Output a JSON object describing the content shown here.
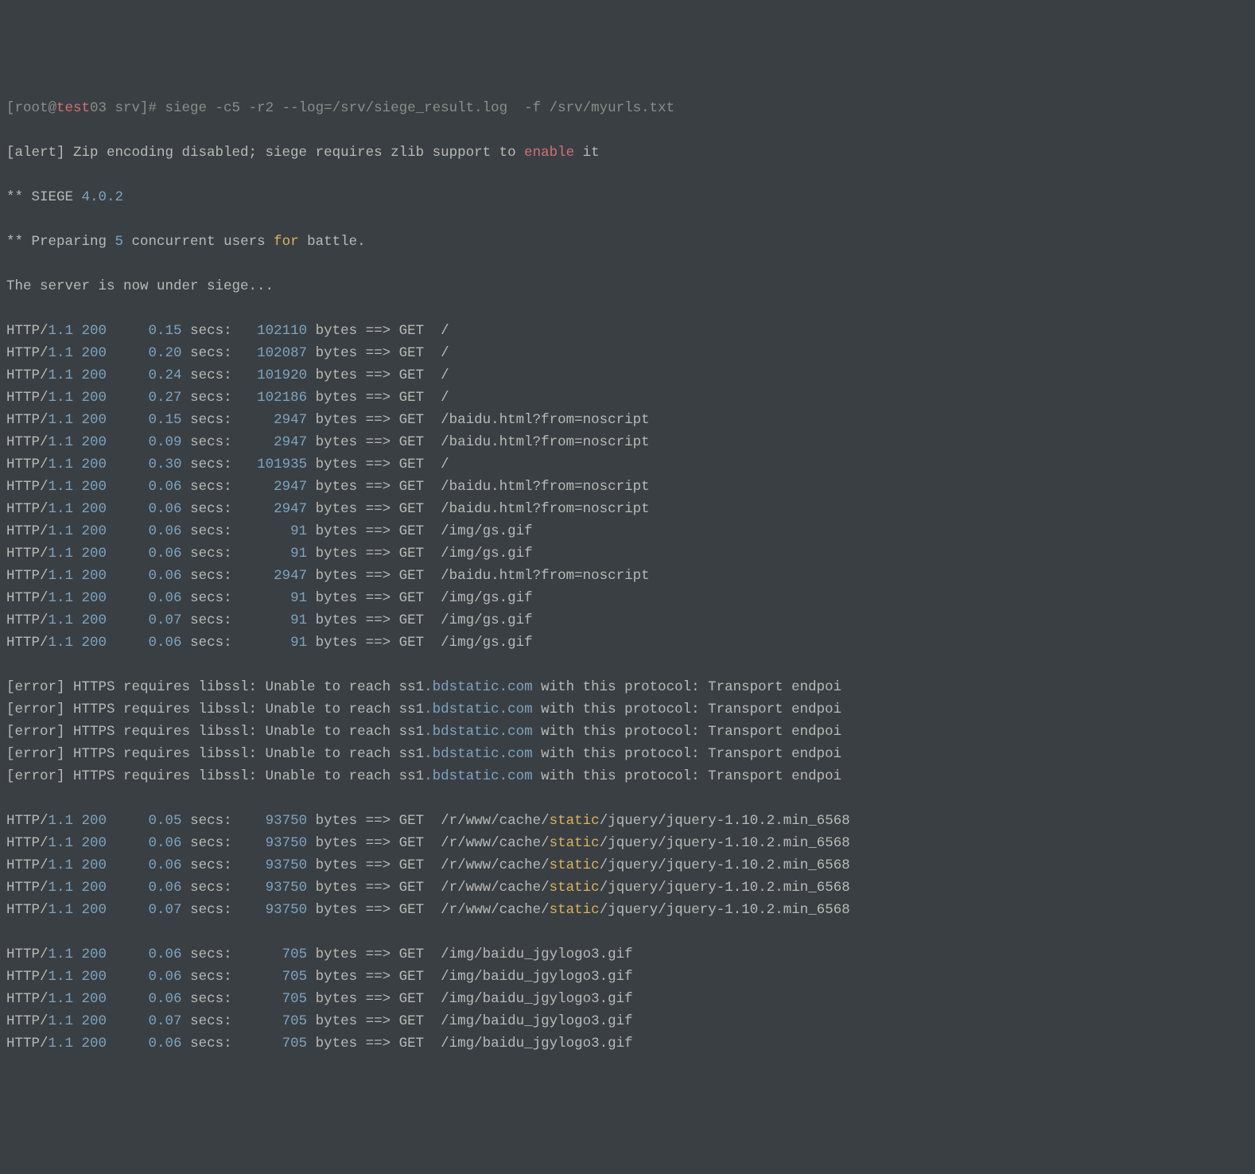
{
  "prompt": {
    "user_host": "[root@",
    "host_red": "test",
    "host_rest": "03 srv]# ",
    "cmd": "siege -c5 -r2 --log=/srv/siege_result.log  -f /srv/myurls.txt"
  },
  "header": {
    "alert_pre": "[alert] Zip encoding disabled; siege requires zlib support to ",
    "alert_enable": "enable",
    "alert_post": " it",
    "siege_stars": "** SIEGE ",
    "siege_ver": "4.0.2",
    "prep_pre": "** Preparing ",
    "prep_n": "5",
    "prep_mid": " concurrent users ",
    "prep_for": "for",
    "prep_post": " battle.",
    "under_siege": "The server is now under siege..."
  },
  "http_label": "HTTP/",
  "bytes_label": "bytes ==> GET  ",
  "secs_label": "secs:",
  "rows": [
    {
      "proto": "1.1 200",
      "time": "0.15",
      "bytes": "102110",
      "path": "/"
    },
    {
      "proto": "1.1 200",
      "time": "0.20",
      "bytes": "102087",
      "path": "/"
    },
    {
      "proto": "1.1 200",
      "time": "0.24",
      "bytes": "101920",
      "path": "/"
    },
    {
      "proto": "1.1 200",
      "time": "0.27",
      "bytes": "102186",
      "path": "/"
    },
    {
      "proto": "1.1 200",
      "time": "0.15",
      "bytes": "2947",
      "path": "/baidu.html?from=noscript"
    },
    {
      "proto": "1.1 200",
      "time": "0.09",
      "bytes": "2947",
      "path": "/baidu.html?from=noscript"
    },
    {
      "proto": "1.1 200",
      "time": "0.30",
      "bytes": "101935",
      "path": "/"
    },
    {
      "proto": "1.1 200",
      "time": "0.06",
      "bytes": "2947",
      "path": "/baidu.html?from=noscript"
    },
    {
      "proto": "1.1 200",
      "time": "0.06",
      "bytes": "2947",
      "path": "/baidu.html?from=noscript"
    },
    {
      "proto": "1.1 200",
      "time": "0.06",
      "bytes": "91",
      "path": "/img/gs.gif"
    },
    {
      "proto": "1.1 200",
      "time": "0.06",
      "bytes": "91",
      "path": "/img/gs.gif"
    },
    {
      "proto": "1.1 200",
      "time": "0.06",
      "bytes": "2947",
      "path": "/baidu.html?from=noscript"
    },
    {
      "proto": "1.1 200",
      "time": "0.06",
      "bytes": "91",
      "path": "/img/gs.gif"
    },
    {
      "proto": "1.1 200",
      "time": "0.07",
      "bytes": "91",
      "path": "/img/gs.gif"
    },
    {
      "proto": "1.1 200",
      "time": "0.06",
      "bytes": "91",
      "path": "/img/gs.gif"
    }
  ],
  "error_pre": "[error] HTTPS requires libssl: Unable to reach ss1",
  "error_mid": ".bdstatic.com",
  "error_post": " with this protocol: Transport endpoi",
  "error_count": 5,
  "rows2": [
    {
      "proto": "1.1 200",
      "time": "0.05",
      "bytes": "93750",
      "p1": "/r/www/cache/",
      "p2": "static",
      "p3": "/jquery/jquery-1.10.2.min_6568"
    },
    {
      "proto": "1.1 200",
      "time": "0.06",
      "bytes": "93750",
      "p1": "/r/www/cache/",
      "p2": "static",
      "p3": "/jquery/jquery-1.10.2.min_6568"
    },
    {
      "proto": "1.1 200",
      "time": "0.06",
      "bytes": "93750",
      "p1": "/r/www/cache/",
      "p2": "static",
      "p3": "/jquery/jquery-1.10.2.min_6568"
    },
    {
      "proto": "1.1 200",
      "time": "0.06",
      "bytes": "93750",
      "p1": "/r/www/cache/",
      "p2": "static",
      "p3": "/jquery/jquery-1.10.2.min_6568"
    },
    {
      "proto": "1.1 200",
      "time": "0.07",
      "bytes": "93750",
      "p1": "/r/www/cache/",
      "p2": "static",
      "p3": "/jquery/jquery-1.10.2.min_6568"
    }
  ],
  "rows3": [
    {
      "proto": "1.1 200",
      "time": "0.06",
      "bytes": "705",
      "path": "/img/baidu_jgylogo3.gif"
    },
    {
      "proto": "1.1 200",
      "time": "0.06",
      "bytes": "705",
      "path": "/img/baidu_jgylogo3.gif"
    },
    {
      "proto": "1.1 200",
      "time": "0.06",
      "bytes": "705",
      "path": "/img/baidu_jgylogo3.gif"
    },
    {
      "proto": "1.1 200",
      "time": "0.07",
      "bytes": "705",
      "path": "/img/baidu_jgylogo3.gif"
    },
    {
      "proto": "1.1 200",
      "time": "0.06",
      "bytes": "705",
      "path": "/img/baidu_jgylogo3.gif"
    }
  ]
}
